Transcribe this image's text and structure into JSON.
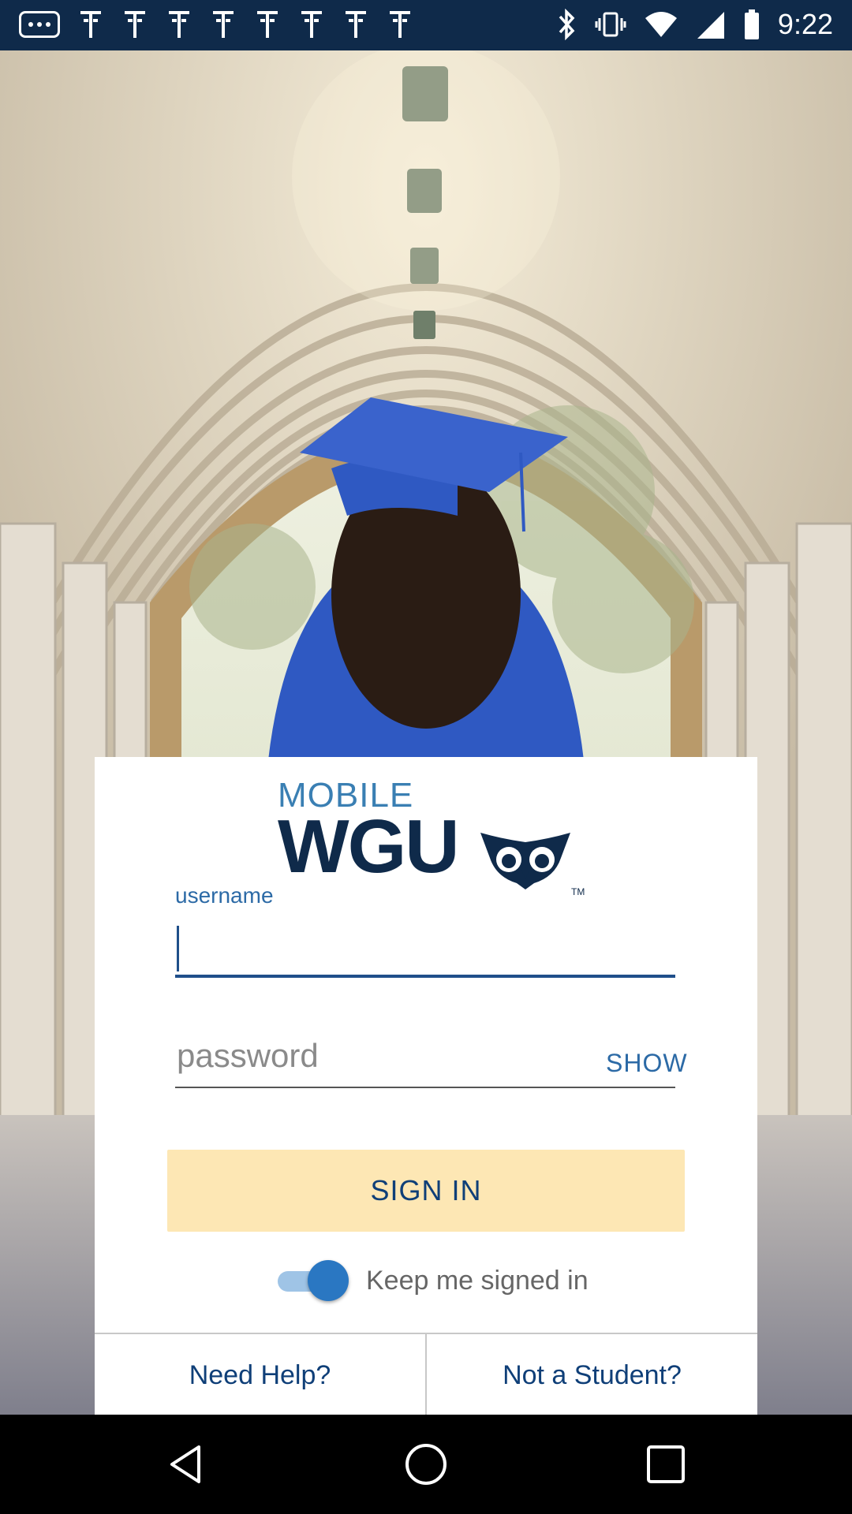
{
  "status_bar": {
    "time": "9:22",
    "icons": [
      "more-dots-icon",
      "notification-icon",
      "notification-icon",
      "notification-icon",
      "notification-icon",
      "notification-icon",
      "notification-icon",
      "notification-icon",
      "notification-icon",
      "bluetooth-icon",
      "vibrate-icon",
      "wifi-icon",
      "signal-icon",
      "battery-icon"
    ]
  },
  "hero": {
    "image": "graduate-in-arched-corridor"
  },
  "logo": {
    "mobile_text": "MOBILE",
    "wgu_text": "WGU",
    "tm": "TM"
  },
  "login": {
    "username_label": "username",
    "username_value": "",
    "password_placeholder": "password",
    "show_label": "SHOW",
    "signin_label": "SIGN IN",
    "keep_signed_in_label": "Keep me signed in",
    "keep_signed_in": true
  },
  "footer": {
    "need_help": "Need Help?",
    "not_student": "Not a Student?"
  },
  "colors": {
    "status_bar": "#0f2a4a",
    "brand_navy": "#0f2a4a",
    "brand_blue": "#3a7fb3",
    "link_blue": "#2c6aa6",
    "signin_bg": "#fde7b4",
    "toggle_on": "#2a77c2"
  },
  "nav": {
    "back_icon": "back-icon",
    "home_icon": "home-icon",
    "recents_icon": "recents-icon"
  }
}
